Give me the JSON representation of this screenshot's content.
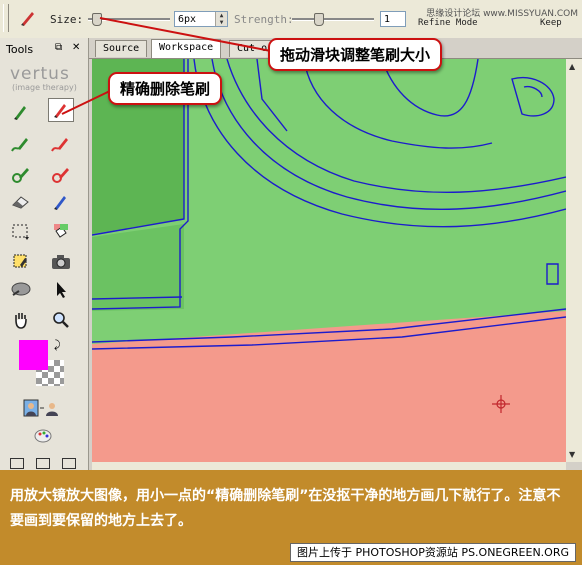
{
  "toolbar": {
    "size_label": "Size:",
    "size_value": "6px",
    "size_slider_fraction": 0.05,
    "strength_label": "Strength:",
    "strength_value": "1",
    "strength_slider_fraction": 0.3,
    "prefix_label": "Refine Mode",
    "keep_label": "Keep",
    "watermark": "思缘设计论坛 www.MISSYUAN.COM"
  },
  "tools_panel": {
    "title": "Tools",
    "logo": "vertus",
    "logo_sub": "(image therapy)",
    "foreground_color": "#ff00ff"
  },
  "tabs": [
    {
      "label": "Source"
    },
    {
      "label": "Workspace"
    },
    {
      "label": "Cut o"
    }
  ],
  "callouts": {
    "slider_tip": "拖动滑块调整笔刷大小",
    "brush_tip": "精确删除笔刷"
  },
  "canvas": {
    "keep_color": "#7ecf74",
    "remove_color": "#f49a8c",
    "edge_color": "#1c1ccc"
  },
  "caption": "用放大镜放大图像，用小一点的“精确删除笔刷”在没抠干净的地方画几下就行了。注意不要画到要保留的地方上去了。",
  "credit": "图片上传于 PHOTOSHOP资源站  PS.ONEGREEN.ORG"
}
